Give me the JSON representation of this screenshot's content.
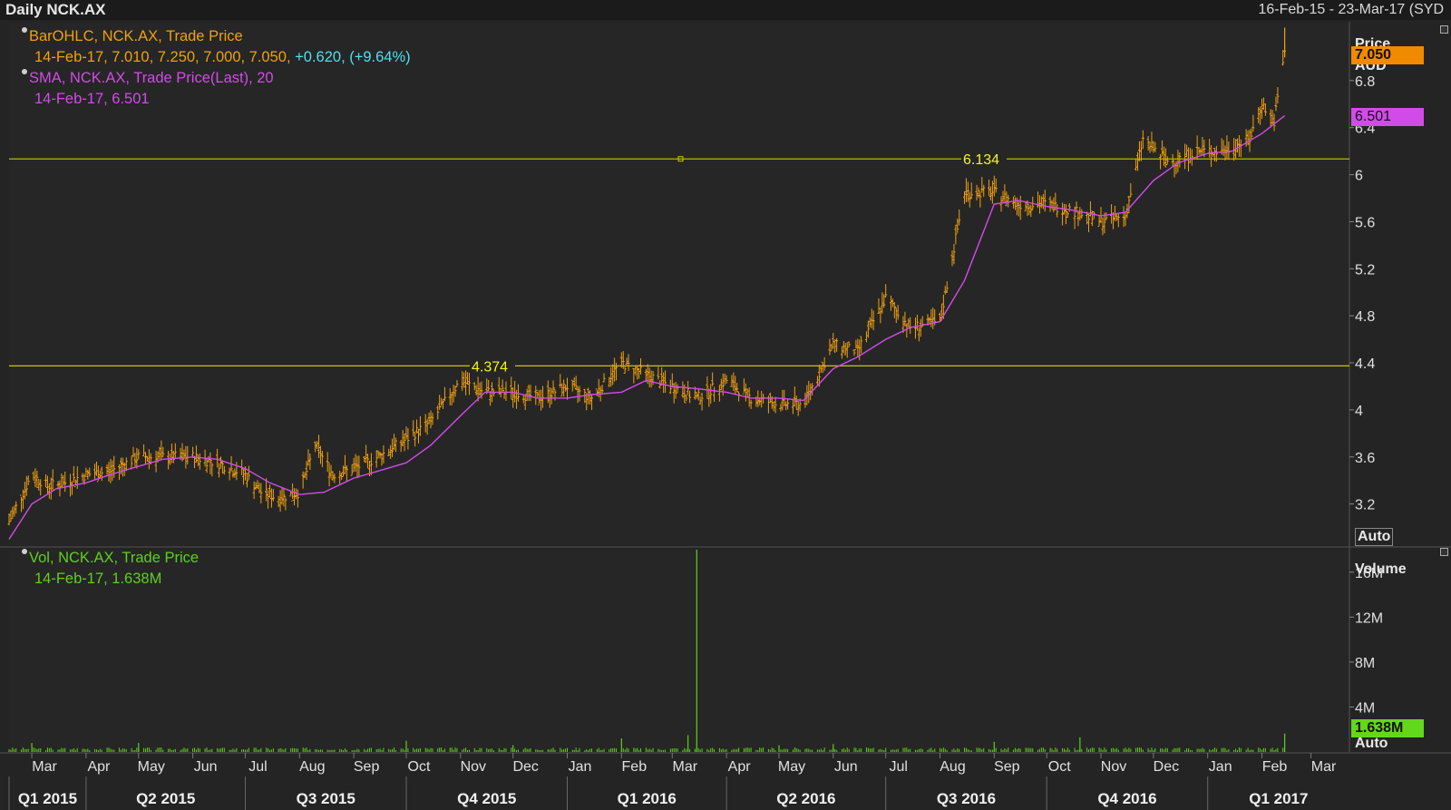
{
  "header": {
    "title": "Daily NCK.AX",
    "date_range": "16-Feb-15 - 23-Mar-17 (SYD"
  },
  "legend": {
    "ohlc_name": "BarOHLC, NCK.AX, Trade Price",
    "ohlc_values": "14-Feb-17, 7.010, 7.250, 7.000, 7.050,",
    "ohlc_change": "+0.620, (+9.64%)",
    "sma_name": "SMA, NCK.AX, Trade Price(Last),  20",
    "sma_values": "14-Feb-17, 6.501",
    "vol_name": "Vol, NCK.AX, Trade Price",
    "vol_values": "14-Feb-17, 1.638M"
  },
  "axis": {
    "price_label": "Price",
    "currency": "AUD",
    "volume_label": "Volume",
    "auto_label": "Auto"
  },
  "badges": {
    "last_price": "7.050",
    "sma": "6.501",
    "volume": "1.638M"
  },
  "colors": {
    "ohlc": "#f0a010",
    "sma": "#d24be8",
    "volume": "#5ed01c",
    "hline": "#c8c800",
    "change": "#4fe0f0"
  },
  "chart_data": [
    {
      "type": "line",
      "title": "Daily NCK.AX",
      "ylabel": "Price",
      "unit": "AUD",
      "ylim": [
        2.85,
        7.3
      ],
      "y_ticks": [
        3.2,
        3.6,
        4,
        4.4,
        4.8,
        5.2,
        5.6,
        6,
        6.4,
        6.8
      ],
      "y_tick_labels": [
        "3.2",
        "3.6",
        "4",
        "4.4",
        "4.8",
        "5.2",
        "5.6",
        "6",
        "6.4",
        "6.8"
      ],
      "month_labels": [
        "Mar",
        "Apr",
        "May",
        "Jun",
        "Jul",
        "Aug",
        "Sep",
        "Oct",
        "Nov",
        "Dec",
        "Jan",
        "Feb",
        "Mar",
        "Apr",
        "May",
        "Jun",
        "Jul",
        "Aug",
        "Sep",
        "Oct",
        "Nov",
        "Dec",
        "Jan",
        "Feb",
        "Mar"
      ],
      "quarter_labels": [
        "Q1 2015",
        "Q2 2015",
        "Q3 2015",
        "Q4 2015",
        "Q1 2016",
        "Q2 2016",
        "Q3 2016",
        "Q4 2016",
        "Q1 2017"
      ],
      "horizontal_lines": [
        {
          "value": 6.134,
          "label": "6.134"
        },
        {
          "value": 4.374,
          "label": "4.374"
        }
      ],
      "series": [
        {
          "name": "BarOHLC, NCK.AX, Trade Price",
          "style": "ohlc-bars",
          "x": [
            "2015-02-16",
            "2015-03-01",
            "2015-03-10",
            "2015-03-20",
            "2015-04-01",
            "2015-04-15",
            "2015-05-01",
            "2015-05-15",
            "2015-06-01",
            "2015-06-15",
            "2015-07-01",
            "2015-07-10",
            "2015-07-20",
            "2015-08-01",
            "2015-08-10",
            "2015-08-20",
            "2015-09-01",
            "2015-09-15",
            "2015-10-01",
            "2015-10-15",
            "2015-11-01",
            "2015-11-15",
            "2015-12-01",
            "2015-12-15",
            "2016-01-01",
            "2016-01-15",
            "2016-02-01",
            "2016-02-15",
            "2016-03-01",
            "2016-03-15",
            "2016-04-01",
            "2016-04-15",
            "2016-05-01",
            "2016-05-15",
            "2016-06-01",
            "2016-06-15",
            "2016-07-01",
            "2016-07-15",
            "2016-08-01",
            "2016-08-15",
            "2016-09-01",
            "2016-09-15",
            "2016-10-01",
            "2016-10-15",
            "2016-11-01",
            "2016-11-15",
            "2016-11-25",
            "2016-12-10",
            "2016-12-25",
            "2017-01-10",
            "2017-01-25",
            "2017-02-01",
            "2017-02-08",
            "2017-02-14"
          ],
          "values": [
            3.05,
            3.45,
            3.35,
            3.38,
            3.45,
            3.48,
            3.6,
            3.6,
            3.6,
            3.55,
            3.45,
            3.3,
            3.25,
            3.3,
            3.7,
            3.45,
            3.5,
            3.6,
            3.75,
            3.9,
            4.25,
            4.15,
            4.15,
            4.1,
            4.2,
            4.1,
            4.4,
            4.3,
            4.2,
            4.1,
            4.25,
            4.1,
            4.05,
            4.05,
            4.55,
            4.5,
            4.95,
            4.7,
            4.75,
            5.85,
            5.85,
            5.75,
            5.75,
            5.7,
            5.6,
            5.65,
            6.3,
            6.1,
            6.2,
            6.2,
            6.3,
            6.6,
            6.45,
            7.05
          ]
        },
        {
          "name": "SMA, NCK.AX, Trade Price(Last),  20",
          "style": "line",
          "x": [
            "2015-02-16",
            "2015-03-01",
            "2015-03-15",
            "2015-04-01",
            "2015-04-15",
            "2015-05-01",
            "2015-05-15",
            "2015-06-01",
            "2015-06-15",
            "2015-07-01",
            "2015-07-15",
            "2015-08-01",
            "2015-08-15",
            "2015-09-01",
            "2015-09-15",
            "2015-10-01",
            "2015-10-15",
            "2015-11-01",
            "2015-11-15",
            "2015-12-01",
            "2015-12-15",
            "2016-01-01",
            "2016-01-15",
            "2016-02-01",
            "2016-02-15",
            "2016-03-01",
            "2016-03-15",
            "2016-04-01",
            "2016-04-15",
            "2016-05-01",
            "2016-05-15",
            "2016-06-01",
            "2016-06-15",
            "2016-07-01",
            "2016-07-15",
            "2016-08-01",
            "2016-08-15",
            "2016-09-01",
            "2016-09-15",
            "2016-10-01",
            "2016-10-15",
            "2016-11-01",
            "2016-11-15",
            "2016-12-01",
            "2016-12-15",
            "2017-01-01",
            "2017-01-15",
            "2017-02-01",
            "2017-02-14"
          ],
          "values": [
            2.9,
            3.2,
            3.33,
            3.38,
            3.45,
            3.52,
            3.58,
            3.6,
            3.58,
            3.5,
            3.38,
            3.28,
            3.3,
            3.42,
            3.48,
            3.55,
            3.7,
            3.95,
            4.15,
            4.15,
            4.1,
            4.1,
            4.13,
            4.15,
            4.25,
            4.2,
            4.18,
            4.15,
            4.1,
            4.1,
            4.08,
            4.35,
            4.45,
            4.6,
            4.7,
            4.75,
            5.1,
            5.75,
            5.78,
            5.73,
            5.7,
            5.65,
            5.68,
            5.95,
            6.1,
            6.18,
            6.2,
            6.35,
            6.501
          ]
        }
      ]
    },
    {
      "type": "bar",
      "title": "Vol, NCK.AX, Trade Price",
      "ylabel": "Volume",
      "ylim": [
        0,
        18000000
      ],
      "y_ticks": [
        4000000,
        8000000,
        12000000,
        16000000
      ],
      "y_tick_labels": [
        "4M",
        "8M",
        "12M",
        "16M"
      ],
      "x": [
        "2015-03-01",
        "2015-05-01",
        "2015-10-01",
        "2015-12-01",
        "2016-02-01",
        "2016-03-10",
        "2016-03-15",
        "2016-05-01",
        "2016-06-01",
        "2016-09-01",
        "2016-10-20",
        "2017-02-14"
      ],
      "values": [
        800000,
        800000,
        1000000,
        600000,
        1200000,
        1500000,
        18000000,
        600000,
        700000,
        900000,
        1300000,
        1638000
      ]
    }
  ]
}
